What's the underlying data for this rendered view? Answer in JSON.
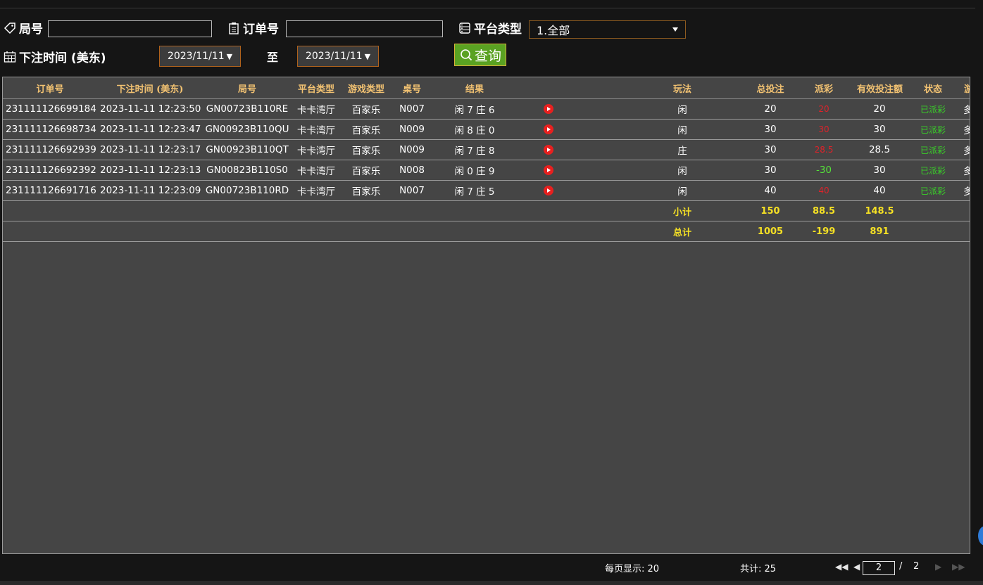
{
  "filters": {
    "round_label": "局号",
    "round_value": "",
    "order_label": "订单号",
    "order_value": "",
    "platform_label": "平台类型",
    "platform_value": "1.全部",
    "bettime_label": "下注时间 (美东)",
    "date_from": "2023/11/11",
    "date_to_label": "至",
    "date_to": "2023/11/11",
    "query_label": "查询"
  },
  "table": {
    "headers": [
      "订单号",
      "下注时间 (美东)",
      "局号",
      "平台类型",
      "游戏类型",
      "桌号",
      "结果",
      "",
      "玩法",
      "总投注",
      "派彩",
      "有效投注额",
      "状态",
      "游戏模式"
    ],
    "rows": [
      {
        "order": "231111126699184",
        "time": "2023-11-11 12:23:50",
        "round": "GN00723B110RE",
        "platform": "卡卡湾厅",
        "game": "百家乐",
        "table": "N007",
        "result": "闲 7 庄 6",
        "play": "闲",
        "bet": "20",
        "payout": "20",
        "payout_color": "red",
        "valid": "20",
        "status": "已派彩",
        "mode": "多台"
      },
      {
        "order": "231111126698734",
        "time": "2023-11-11 12:23:47",
        "round": "GN00923B110QU",
        "platform": "卡卡湾厅",
        "game": "百家乐",
        "table": "N009",
        "result": "闲 8 庄 0",
        "play": "闲",
        "bet": "30",
        "payout": "30",
        "payout_color": "red",
        "valid": "30",
        "status": "已派彩",
        "mode": "多台"
      },
      {
        "order": "231111126692939",
        "time": "2023-11-11 12:23:17",
        "round": "GN00923B110QT",
        "platform": "卡卡湾厅",
        "game": "百家乐",
        "table": "N009",
        "result": "闲 7 庄 8",
        "play": "庄",
        "bet": "30",
        "payout": "28.5",
        "payout_color": "red",
        "valid": "28.5",
        "status": "已派彩",
        "mode": "多台"
      },
      {
        "order": "231111126692392",
        "time": "2023-11-11 12:23:13",
        "round": "GN00823B110S0",
        "platform": "卡卡湾厅",
        "game": "百家乐",
        "table": "N008",
        "result": "闲 0 庄 9",
        "play": "闲",
        "bet": "30",
        "payout": "-30",
        "payout_color": "green",
        "valid": "30",
        "status": "已派彩",
        "mode": "多台"
      },
      {
        "order": "231111126691716",
        "time": "2023-11-11 12:23:09",
        "round": "GN00723B110RD",
        "platform": "卡卡湾厅",
        "game": "百家乐",
        "table": "N007",
        "result": "闲 7 庄 5",
        "play": "闲",
        "bet": "40",
        "payout": "40",
        "payout_color": "red",
        "valid": "40",
        "status": "已派彩",
        "mode": "多台"
      }
    ],
    "subtotal": {
      "label": "小计",
      "bet": "150",
      "payout": "88.5",
      "valid": "148.5"
    },
    "total": {
      "label": "总计",
      "bet": "1005",
      "payout": "-199",
      "valid": "891"
    }
  },
  "footer": {
    "per_page": "每页显示: 20",
    "total_count": "共计: 25",
    "current_page": "2",
    "separator": "/",
    "total_pages": "2"
  },
  "colors": {
    "header_text": "#f2c272",
    "sum_text": "#f5e024",
    "status_green": "#39d028",
    "payout_red": "#e0222a",
    "payout_green": "#55e03a",
    "query_button": "#5aa222"
  }
}
